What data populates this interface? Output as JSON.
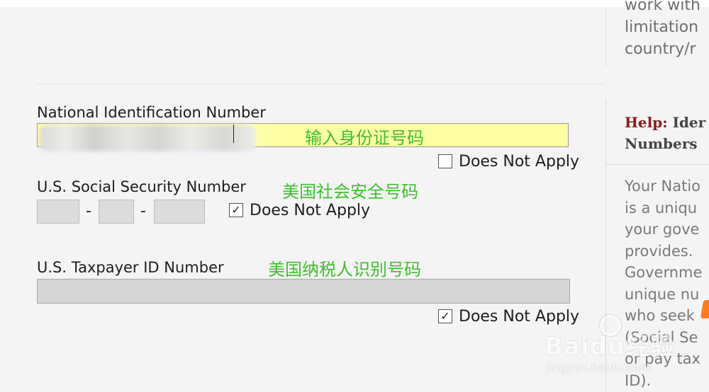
{
  "form": {
    "national_id": {
      "label": "National Identification Number",
      "annotation": "输入身份证号码",
      "does_not_apply_label": "Does Not Apply",
      "does_not_apply_checked": false
    },
    "ssn": {
      "label": "U.S. Social Security Number",
      "annotation": "美国社会安全号码",
      "separator": "-",
      "does_not_apply_label": "Does Not Apply",
      "does_not_apply_checked": true
    },
    "taxpayer_id": {
      "label": "U.S. Taxpayer ID Number",
      "annotation": "美国纳税人识别号码",
      "does_not_apply_label": "Does Not Apply",
      "does_not_apply_checked": true
    }
  },
  "help_panel": {
    "top_fragment_lines": [
      "work with",
      "limitation",
      "country/r"
    ],
    "title_prefix": "Help:",
    "title_rest_line1": "Ider",
    "title_rest_line2": "Numbers",
    "body_lines": [
      "Your Natio",
      "is a uniqu",
      "your gove",
      "provides.",
      "Governme",
      "unique nu",
      "who seek",
      "(Social Se",
      "or pay tax",
      "ID)."
    ]
  },
  "watermark": {
    "brand": "Baidu经验",
    "url": "jingyan.baidu.com"
  },
  "colors": {
    "page_background": "#f4f4f4",
    "national_id_input_bg": "#ffffa6",
    "annotation_green": "#3fbf2f",
    "help_title_red": "#8b1a1a",
    "disabled_input_bg": "#d6d6d6"
  },
  "icons": {
    "checkbox_checked": "check-mark"
  }
}
